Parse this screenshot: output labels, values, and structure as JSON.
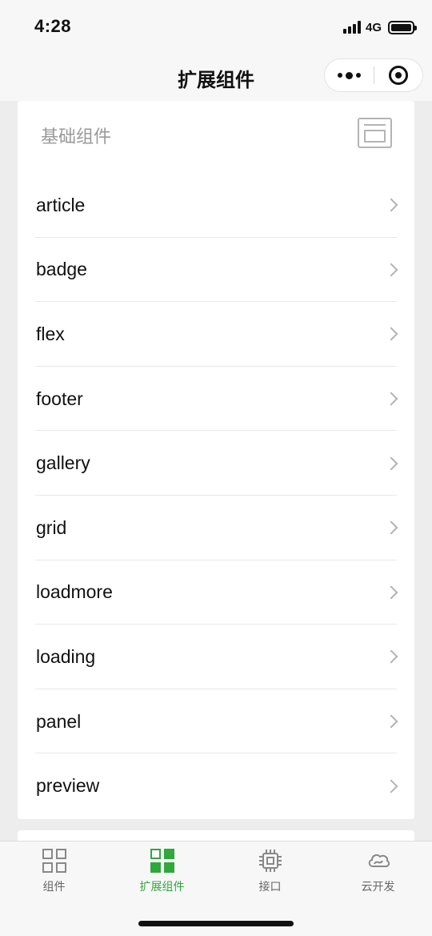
{
  "status_bar": {
    "time": "4:28",
    "network": "4G"
  },
  "nav": {
    "title": "扩展组件"
  },
  "section": {
    "title": "基础组件",
    "items": [
      {
        "label": "article"
      },
      {
        "label": "badge"
      },
      {
        "label": "flex"
      },
      {
        "label": "footer"
      },
      {
        "label": "gallery"
      },
      {
        "label": "grid"
      },
      {
        "label": "loadmore"
      },
      {
        "label": "loading"
      },
      {
        "label": "panel"
      },
      {
        "label": "preview"
      }
    ]
  },
  "tab_bar": {
    "tabs": [
      {
        "label": "组件",
        "icon": "grid-icon",
        "active": false
      },
      {
        "label": "扩展组件",
        "icon": "grid-filled-icon",
        "active": true
      },
      {
        "label": "接口",
        "icon": "chip-icon",
        "active": false
      },
      {
        "label": "云开发",
        "icon": "cloud-icon",
        "active": false
      }
    ],
    "active_color": "#2fa83c",
    "inactive_color": "#666666"
  }
}
